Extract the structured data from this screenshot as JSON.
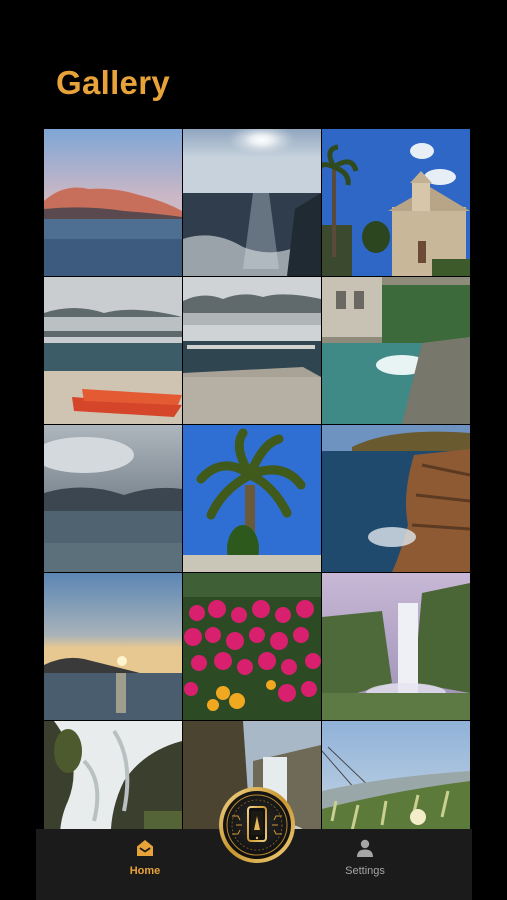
{
  "header": {
    "title": "Gallery"
  },
  "gallery": {
    "photos": [
      {
        "icon": "coastal-sunset-photo"
      },
      {
        "icon": "sun-over-sea-photo"
      },
      {
        "icon": "church-palm-photo"
      },
      {
        "icon": "kayaks-bay-photo"
      },
      {
        "icon": "harbor-pier-photo"
      },
      {
        "icon": "canal-water-photo"
      },
      {
        "icon": "cloudy-bay-photo"
      },
      {
        "icon": "palm-tree-photo"
      },
      {
        "icon": "rocky-cliff-photo"
      },
      {
        "icon": "sunset-sea-photo"
      },
      {
        "icon": "pink-flowers-photo"
      },
      {
        "icon": "waterfall-photo"
      },
      {
        "icon": "cascade-photo"
      },
      {
        "icon": "mountain-waterfall-photo"
      },
      {
        "icon": "beach-grass-photo"
      }
    ]
  },
  "tabbar": {
    "home_label": "Home",
    "settings_label": "Settings",
    "home_icon": "home-icon",
    "settings_icon": "person-icon",
    "center_icon": "phone-badge-icon"
  },
  "colors": {
    "accent": "#E8A23A",
    "background": "#000000",
    "tabbar": "#1B1B1B",
    "inactive": "#A6A6A6"
  }
}
